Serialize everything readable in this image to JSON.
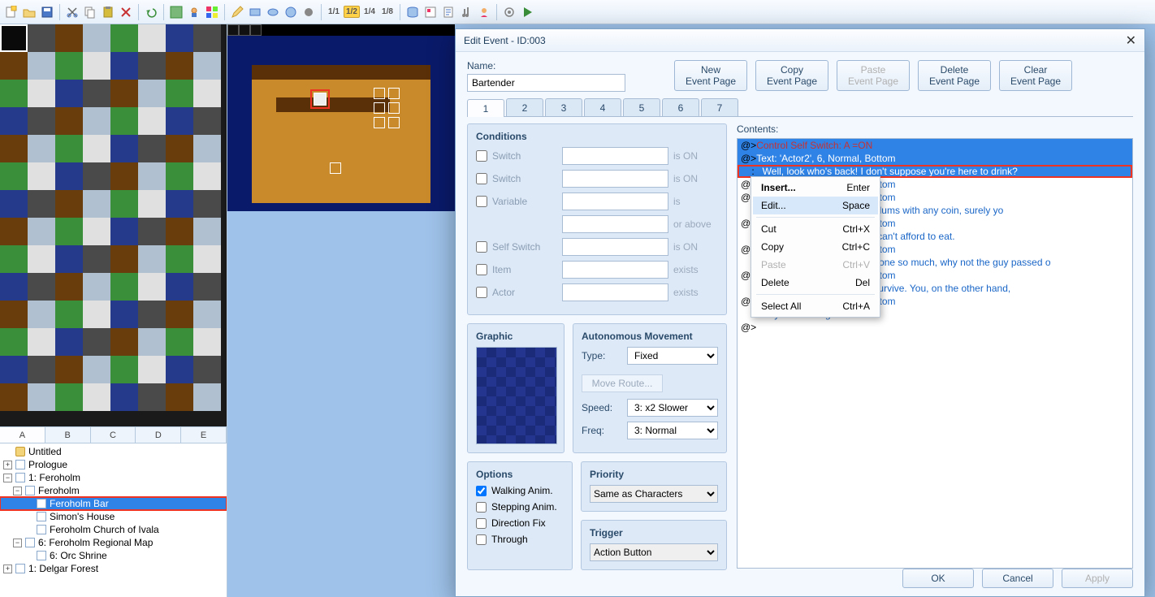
{
  "toolbar": {
    "fractions": [
      "1/1",
      "1/2",
      "1/4",
      "1/8"
    ],
    "active_fraction": "1/2"
  },
  "tiletabs": [
    "A",
    "B",
    "C",
    "D",
    "E"
  ],
  "tiletab_active": "A",
  "maptree": [
    {
      "ind": 0,
      "icon": "proj",
      "exp": "",
      "label": "Untitled"
    },
    {
      "ind": 0,
      "icon": "page",
      "exp": "+",
      "label": "Prologue"
    },
    {
      "ind": 0,
      "icon": "page",
      "exp": "-",
      "label": "1: Feroholm"
    },
    {
      "ind": 1,
      "icon": "page",
      "exp": "-",
      "label": "Feroholm"
    },
    {
      "ind": 2,
      "icon": "page",
      "exp": "",
      "label": "Feroholm Bar",
      "selected": true,
      "boxed": true
    },
    {
      "ind": 2,
      "icon": "page",
      "exp": "",
      "label": "Simon's House"
    },
    {
      "ind": 2,
      "icon": "page",
      "exp": "",
      "label": "Feroholm Church of Ivala"
    },
    {
      "ind": 1,
      "icon": "page",
      "exp": "-",
      "label": "6: Feroholm Regional Map"
    },
    {
      "ind": 2,
      "icon": "page",
      "exp": "",
      "label": "6: Orc Shrine"
    },
    {
      "ind": 0,
      "icon": "page",
      "exp": "+",
      "label": "1: Delgar Forest"
    }
  ],
  "dialog": {
    "title": "Edit Event - ID:003",
    "name_label": "Name:",
    "name_value": "Bartender",
    "pagebtns": [
      {
        "l1": "New",
        "l2": "Event Page",
        "disabled": false
      },
      {
        "l1": "Copy",
        "l2": "Event Page",
        "disabled": false
      },
      {
        "l1": "Paste",
        "l2": "Event Page",
        "disabled": true
      },
      {
        "l1": "Delete",
        "l2": "Event Page",
        "disabled": false
      },
      {
        "l1": "Clear",
        "l2": "Event Page",
        "disabled": false
      }
    ],
    "tabs": [
      "1",
      "2",
      "3",
      "4",
      "5",
      "6",
      "7"
    ],
    "tab_active": "1",
    "conditions": {
      "legend": "Conditions",
      "rows": [
        {
          "label": "Switch",
          "suffix": "is ON"
        },
        {
          "label": "Switch",
          "suffix": "is ON"
        },
        {
          "label": "Variable",
          "suffix": "is"
        },
        {
          "label": "",
          "suffix": "or above",
          "nobox": true
        },
        {
          "label": "Self Switch",
          "suffix": "is ON"
        },
        {
          "label": "Item",
          "suffix": "exists"
        },
        {
          "label": "Actor",
          "suffix": "exists"
        }
      ]
    },
    "graphic_legend": "Graphic",
    "amove": {
      "legend": "Autonomous Movement",
      "type_label": "Type:",
      "type_value": "Fixed",
      "moveroute": "Move Route...",
      "speed_label": "Speed:",
      "speed_value": "3: x2 Slower",
      "freq_label": "Freq:",
      "freq_value": "3: Normal"
    },
    "options": {
      "legend": "Options",
      "rows": [
        {
          "label": "Walking Anim.",
          "checked": true
        },
        {
          "label": "Stepping Anim.",
          "checked": false
        },
        {
          "label": "Direction Fix",
          "checked": false
        },
        {
          "label": "Through",
          "checked": false
        }
      ]
    },
    "priority": {
      "legend": "Priority",
      "value": "Same as Characters"
    },
    "trigger": {
      "legend": "Trigger",
      "value": "Action Button"
    },
    "contents_label": "Contents:",
    "contents": [
      {
        "cls": "selfswitch",
        "marker": "@>",
        "text": "Control Self Switch: A =ON"
      },
      {
        "cls": "textheader sel",
        "marker": "@>",
        "text": "Text: 'Actor2', 6, Normal, Bottom"
      },
      {
        "cls": "textbody sel boxed",
        "marker": ": ",
        "text": "Well, look who's back! I don't suppose you're here to drink?"
      },
      {
        "cls": "textheader",
        "marker": "@>",
        "text": "Text: 'Actor2', 6, Normal, Bottom"
      },
      {
        "cls": "textheader",
        "marker": "@>",
        "text": "Text: 'Actor2', 6, Normal, Bottom"
      },
      {
        "cls": "textbody",
        "marker": ": ",
        "text": "You're the only one in the slums with any coin, surely yo"
      },
      {
        "cls": "textheader",
        "marker": "@>",
        "text": "Text: 'Actor2', 6, Normal, Bottom"
      },
      {
        "cls": "textbody",
        "marker": ": ",
        "text": "Drinking when some of us can't afford to eat."
      },
      {
        "cls": "textheader",
        "marker": "@>",
        "text": "Text: 'Actor2', 6, Normal, Bottom"
      },
      {
        "cls": "textbody",
        "marker": ": ",
        "text": "If you want to lecture someone so much, why not the guy passed o"
      },
      {
        "cls": "textheader",
        "marker": "@>",
        "text": "Text: 'Actor2', 6, Normal, Bottom"
      },
      {
        "cls": "textbody",
        "marker": ": ",
        "text": "He drinks he has to do to survive. You, on the other hand,"
      },
      {
        "cls": "textheader",
        "marker": "@>",
        "text": "Text: 'Actor2', 6, Normal, Bottom"
      },
      {
        "cls": "textbody",
        "marker": ": ",
        "text": "Buy a drink or get out!"
      },
      {
        "cls": "marker",
        "marker": "@>",
        "text": ""
      }
    ],
    "buttons": {
      "ok": "OK",
      "cancel": "Cancel",
      "apply": "Apply"
    }
  },
  "ctxmenu": [
    {
      "label": "Insert...",
      "shortcut": "Enter",
      "bold": true
    },
    {
      "label": "Edit...",
      "shortcut": "Space",
      "hover": true
    },
    {
      "sep": true
    },
    {
      "label": "Cut",
      "shortcut": "Ctrl+X"
    },
    {
      "label": "Copy",
      "shortcut": "Ctrl+C"
    },
    {
      "label": "Paste",
      "shortcut": "Ctrl+V",
      "disabled": true
    },
    {
      "label": "Delete",
      "shortcut": "Del"
    },
    {
      "sep": true
    },
    {
      "label": "Select All",
      "shortcut": "Ctrl+A"
    }
  ]
}
